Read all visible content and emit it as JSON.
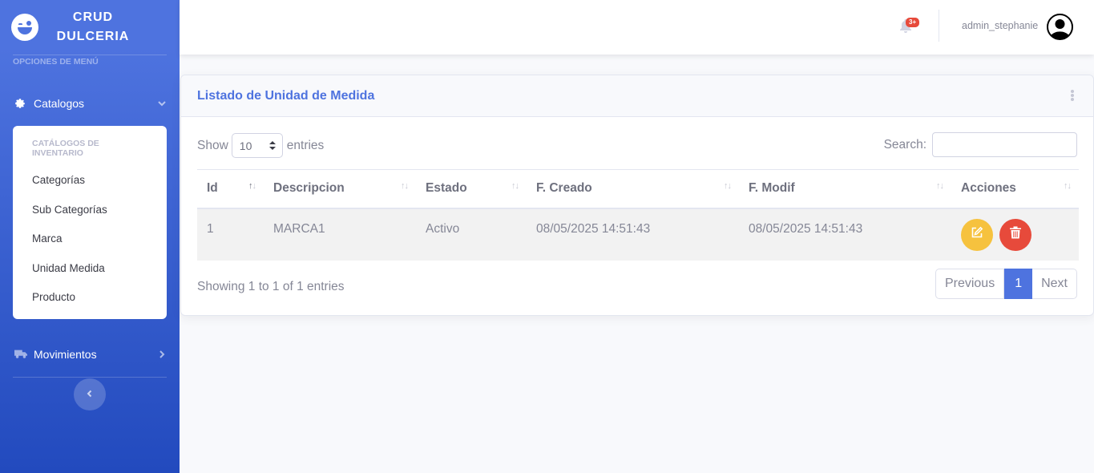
{
  "sidebar": {
    "brand_line1": "CRUD",
    "brand_line2": "DULCERIA",
    "heading": "OPCIONES DE MENÚ",
    "catalogos_label": "Catalogos",
    "submenu_header": "CATÁLOGOS DE INVENTARIO",
    "submenu_items": [
      "Categorías",
      "Sub Categorías",
      "Marca",
      "Unidad Medida",
      "Producto"
    ],
    "movimientos_label": "Movimientos",
    "icons": {
      "catalogos": "gear-icon",
      "movimientos": "truck-icon",
      "toggle": "chevron-left-icon"
    }
  },
  "topbar": {
    "notification_count": "3+",
    "username": "admin_stephanie"
  },
  "card": {
    "title": "Listado de Unidad de Medida",
    "show_label": "Show",
    "entries_label": "entries",
    "page_length": "10",
    "search_label": "Search:",
    "search_value": "",
    "columns": [
      "Id",
      "Descripcion",
      "Estado",
      "F. Creado",
      "F. Modif",
      "Acciones"
    ],
    "rows": [
      {
        "id": "1",
        "descripcion": "MARCA1",
        "estado": "Activo",
        "creado": "08/05/2025 14:51:43",
        "modif": "08/05/2025 14:51:43"
      }
    ],
    "info": "Showing 1 to 1 of 1 entries",
    "pagination": {
      "previous": "Previous",
      "current": "1",
      "next": "Next"
    }
  },
  "colors": {
    "primary": "#4e73df",
    "warning": "#f6c23e",
    "danger": "#e74a3b"
  }
}
